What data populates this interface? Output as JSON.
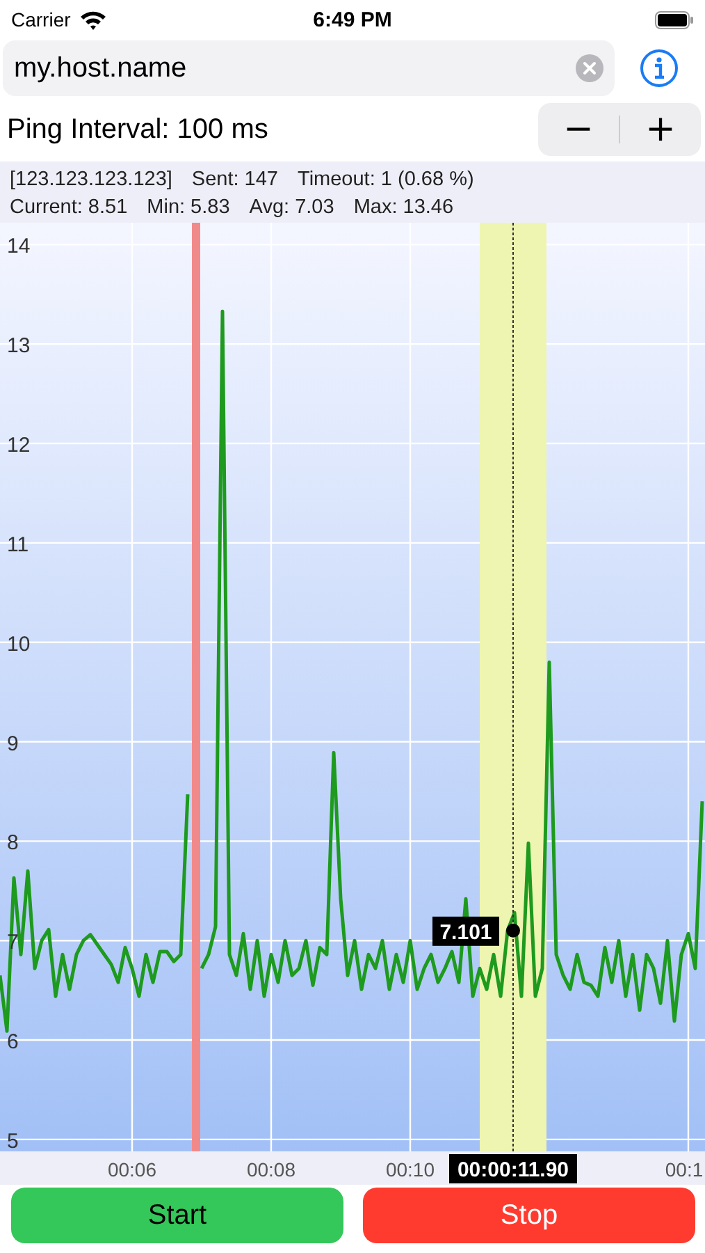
{
  "status_bar": {
    "carrier": "Carrier",
    "time": "6:49 PM"
  },
  "host_field": {
    "value": "my.host.name"
  },
  "ping_interval": {
    "label": "Ping Interval: 100 ms",
    "stepper": [
      "−",
      "+"
    ]
  },
  "stats": [
    [
      "[123.123.123.123]",
      "Sent: 147",
      "Timeout: 1 (0.68 %)"
    ],
    [
      "Current: 8.51",
      "Min: 5.83",
      "Avg: 7.03",
      "Max: 13.46"
    ]
  ],
  "chart": {
    "chart_data": {
      "type": "line",
      "grid": true,
      "x": [
        4.1,
        4.2,
        4.3,
        4.4,
        4.5,
        4.6,
        4.7,
        4.8,
        4.9,
        5.0,
        5.1,
        5.2,
        5.3,
        5.4,
        5.5,
        5.6,
        5.7,
        5.8,
        5.9,
        6.0,
        6.1,
        6.2,
        6.3,
        6.4,
        6.5,
        6.6,
        6.7,
        6.8,
        6.9,
        7.0,
        7.1,
        7.2,
        7.3,
        7.4,
        7.5,
        7.6,
        7.7,
        7.8,
        7.9,
        8.0,
        8.1,
        8.2,
        8.3,
        8.4,
        8.5,
        8.6,
        8.7,
        8.8,
        8.9,
        9.0,
        9.1,
        9.2,
        9.3,
        9.4,
        9.5,
        9.6,
        9.7,
        9.8,
        9.9,
        10.0,
        10.1,
        10.2,
        10.3,
        10.4,
        10.5,
        10.6,
        10.7,
        10.8,
        10.9,
        11.0,
        11.1,
        11.2,
        11.3,
        11.4,
        11.5,
        11.6,
        11.7,
        11.8,
        11.9,
        12.0,
        12.1,
        12.2,
        12.3,
        12.4,
        12.5,
        12.6,
        12.7,
        12.8,
        12.9,
        13.0,
        13.1,
        13.2,
        13.3,
        13.4,
        13.5,
        13.6,
        13.7,
        13.8,
        13.9,
        14.0,
        14.1,
        14.2
      ],
      "series": [
        {
          "color": "#1e9a1e",
          "values": [
            6.65,
            6.09,
            7.63,
            6.86,
            7.7,
            6.72,
            7.0,
            7.11,
            6.44,
            6.86,
            6.51,
            6.86,
            7.0,
            7.06,
            6.96,
            6.86,
            6.76,
            6.58,
            6.93,
            6.72,
            6.44,
            6.86,
            6.58,
            6.89,
            6.89,
            6.79,
            6.86,
            8.47,
            null,
            6.72,
            6.86,
            7.14,
            13.33,
            6.86,
            6.65,
            7.07,
            6.51,
            7.0,
            6.44,
            6.86,
            6.58,
            7.0,
            6.65,
            6.72,
            7.0,
            6.55,
            6.93,
            6.86,
            8.89,
            7.42,
            6.65,
            7.0,
            6.51,
            6.86,
            6.72,
            7.0,
            6.51,
            6.86,
            6.58,
            7.0,
            6.51,
            6.72,
            6.86,
            6.58,
            6.72,
            6.89,
            6.58,
            7.42,
            6.44,
            6.72,
            6.51,
            6.86,
            6.44,
            7.1,
            7.28,
            6.44,
            7.98,
            6.44,
            6.72,
            9.8,
            6.86,
            6.65,
            6.51,
            6.86,
            6.58,
            6.55,
            6.44,
            6.93,
            6.58,
            7.0,
            6.44,
            6.86,
            6.3,
            6.86,
            6.72,
            6.37,
            7.0,
            6.19,
            6.86,
            7.07,
            6.72,
            8.4
          ]
        }
      ],
      "xlim": [
        4.1,
        14.24
      ],
      "ylim": [
        4.88,
        14.22
      ],
      "xticks": [
        {
          "value": 6,
          "label": "00:06"
        },
        {
          "value": 8,
          "label": "00:08"
        },
        {
          "value": 10,
          "label": "00:10"
        },
        {
          "value": 14,
          "label": "00:1"
        }
      ],
      "yticks": [
        5,
        6,
        7,
        8,
        9,
        10,
        11,
        12,
        13,
        14
      ],
      "bands": [
        {
          "axis": "x",
          "from": 6.86,
          "to": 6.98,
          "color": "#f08a8a"
        },
        {
          "axis": "x",
          "from": 11.0,
          "to": 11.96,
          "color": "#eef5b0"
        }
      ],
      "ref_lines": [
        {
          "axis": "x",
          "value": 11.48,
          "color": "#333333"
        }
      ],
      "annotations": [
        {
          "text": "7.101",
          "x": 11.48,
          "y": 7.101
        },
        "00:00:11.90"
      ]
    }
  },
  "buttons": [
    {
      "label": "Start",
      "kind": "start"
    },
    {
      "label": "Stop",
      "kind": "stop"
    }
  ]
}
